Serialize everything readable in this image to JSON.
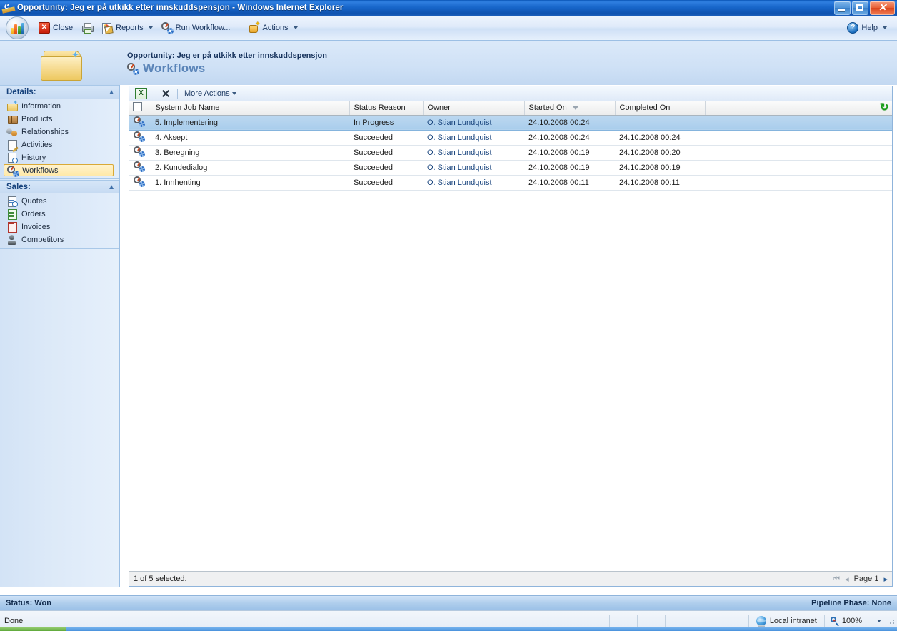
{
  "window": {
    "title": "Opportunity: Jeg er på utkikk etter innskuddspensjon - Windows Internet Explorer",
    "browser_icon": "internet-explorer-icon",
    "minimize_label": "",
    "maximize_label": "",
    "close_label": "✕"
  },
  "toolbar": {
    "logo": "dynamics-crm-logo",
    "buttons": [
      {
        "label": "Close",
        "icon": "close-red-x-icon",
        "accel": "C"
      },
      {
        "label": "",
        "icon": "print-icon",
        "accel": ""
      },
      {
        "label": "Reports",
        "icon": "reports-icon",
        "has_caret": true
      },
      {
        "label": "Run Workflow...",
        "icon": "run-workflow-icon",
        "has_caret": false
      },
      {
        "label": "Actions",
        "icon": "actions-icon",
        "has_caret": true
      }
    ],
    "help_label": "Help",
    "help_icon": "help-icon"
  },
  "page_header": {
    "folder_icon": "folder-icon",
    "subtitle": "Opportunity: Jeg er på utkikk etter innskuddspensjon",
    "title": "Workflows",
    "title_icon": "workflow-icon",
    "title_color": "#5a84b8"
  },
  "sidebar": {
    "groups": [
      {
        "header": "Details:",
        "collapse_icon": "chevron-up-icon",
        "items": [
          {
            "label": "Information",
            "icon": "information-folder-icon",
            "selected": false
          },
          {
            "label": "Products",
            "icon": "products-box-icon",
            "selected": false
          },
          {
            "label": "Relationships",
            "icon": "relationships-people-icon",
            "selected": false
          },
          {
            "label": "Activities",
            "icon": "activities-notepad-icon",
            "selected": false
          },
          {
            "label": "History",
            "icon": "history-clock-icon",
            "selected": false
          },
          {
            "label": "Workflows",
            "icon": "workflows-icon",
            "selected": true
          }
        ]
      },
      {
        "header": "Sales:",
        "collapse_icon": "chevron-up-icon",
        "items": [
          {
            "label": "Quotes",
            "icon": "quotes-icon",
            "selected": false
          },
          {
            "label": "Orders",
            "icon": "orders-icon",
            "selected": false
          },
          {
            "label": "Invoices",
            "icon": "invoices-icon",
            "selected": false
          },
          {
            "label": "Competitors",
            "icon": "competitors-icon",
            "selected": false
          }
        ]
      }
    ]
  },
  "grid": {
    "toolbar": {
      "export_icon": "export-to-excel-icon",
      "delete_icon": "delete-x-icon",
      "more_actions_label": "More Actions"
    },
    "refresh_icon": "refresh-icon",
    "select_all_checkbox": "select-all-checkbox",
    "columns": [
      {
        "key": "icon",
        "label": ""
      },
      {
        "key": "name",
        "label": "System Job Name",
        "sorted": false
      },
      {
        "key": "status",
        "label": "Status Reason",
        "sorted": false
      },
      {
        "key": "owner",
        "label": "Owner",
        "sorted": false
      },
      {
        "key": "started",
        "label": "Started On",
        "sorted": true,
        "sort_dir": "desc"
      },
      {
        "key": "completed",
        "label": "Completed On",
        "sorted": false
      },
      {
        "key": "spacer",
        "label": ""
      }
    ],
    "rows": [
      {
        "name": "5. Implementering",
        "status": "In Progress",
        "owner": "O. Stian Lundquist",
        "started": "24.10.2008 00:24",
        "completed": "",
        "selected": true
      },
      {
        "name": "4. Aksept",
        "status": "Succeeded",
        "owner": "O. Stian Lundquist",
        "started": "24.10.2008 00:24",
        "completed": "24.10.2008 00:24",
        "selected": false
      },
      {
        "name": "3. Beregning",
        "status": "Succeeded",
        "owner": "O. Stian Lundquist",
        "started": "24.10.2008 00:19",
        "completed": "24.10.2008 00:20",
        "selected": false
      },
      {
        "name": "2. Kundedialog",
        "status": "Succeeded",
        "owner": "O. Stian Lundquist",
        "started": "24.10.2008 00:19",
        "completed": "24.10.2008 00:19",
        "selected": false
      },
      {
        "name": "1. Innhenting",
        "status": "Succeeded",
        "owner": "O. Stian Lundquist",
        "started": "24.10.2008 00:11",
        "completed": "24.10.2008 00:11",
        "selected": false
      }
    ],
    "footer": {
      "selection_text": "1 of 5 selected.",
      "first_page_icon": "first-page-icon",
      "prev_page_icon": "previous-page-icon",
      "page_label": "Page 1",
      "next_page_icon": "next-page-icon"
    }
  },
  "crm_status_bar": {
    "left": "Status: Won",
    "right": "Pipeline Phase: None"
  },
  "ie_status_bar": {
    "message": "Done",
    "zone_icon": "local-intranet-icon",
    "zone": "Local intranet",
    "zoom_icon": "zoom-magnifier-icon",
    "zoom": "100%",
    "zoom_caret": "▾"
  }
}
